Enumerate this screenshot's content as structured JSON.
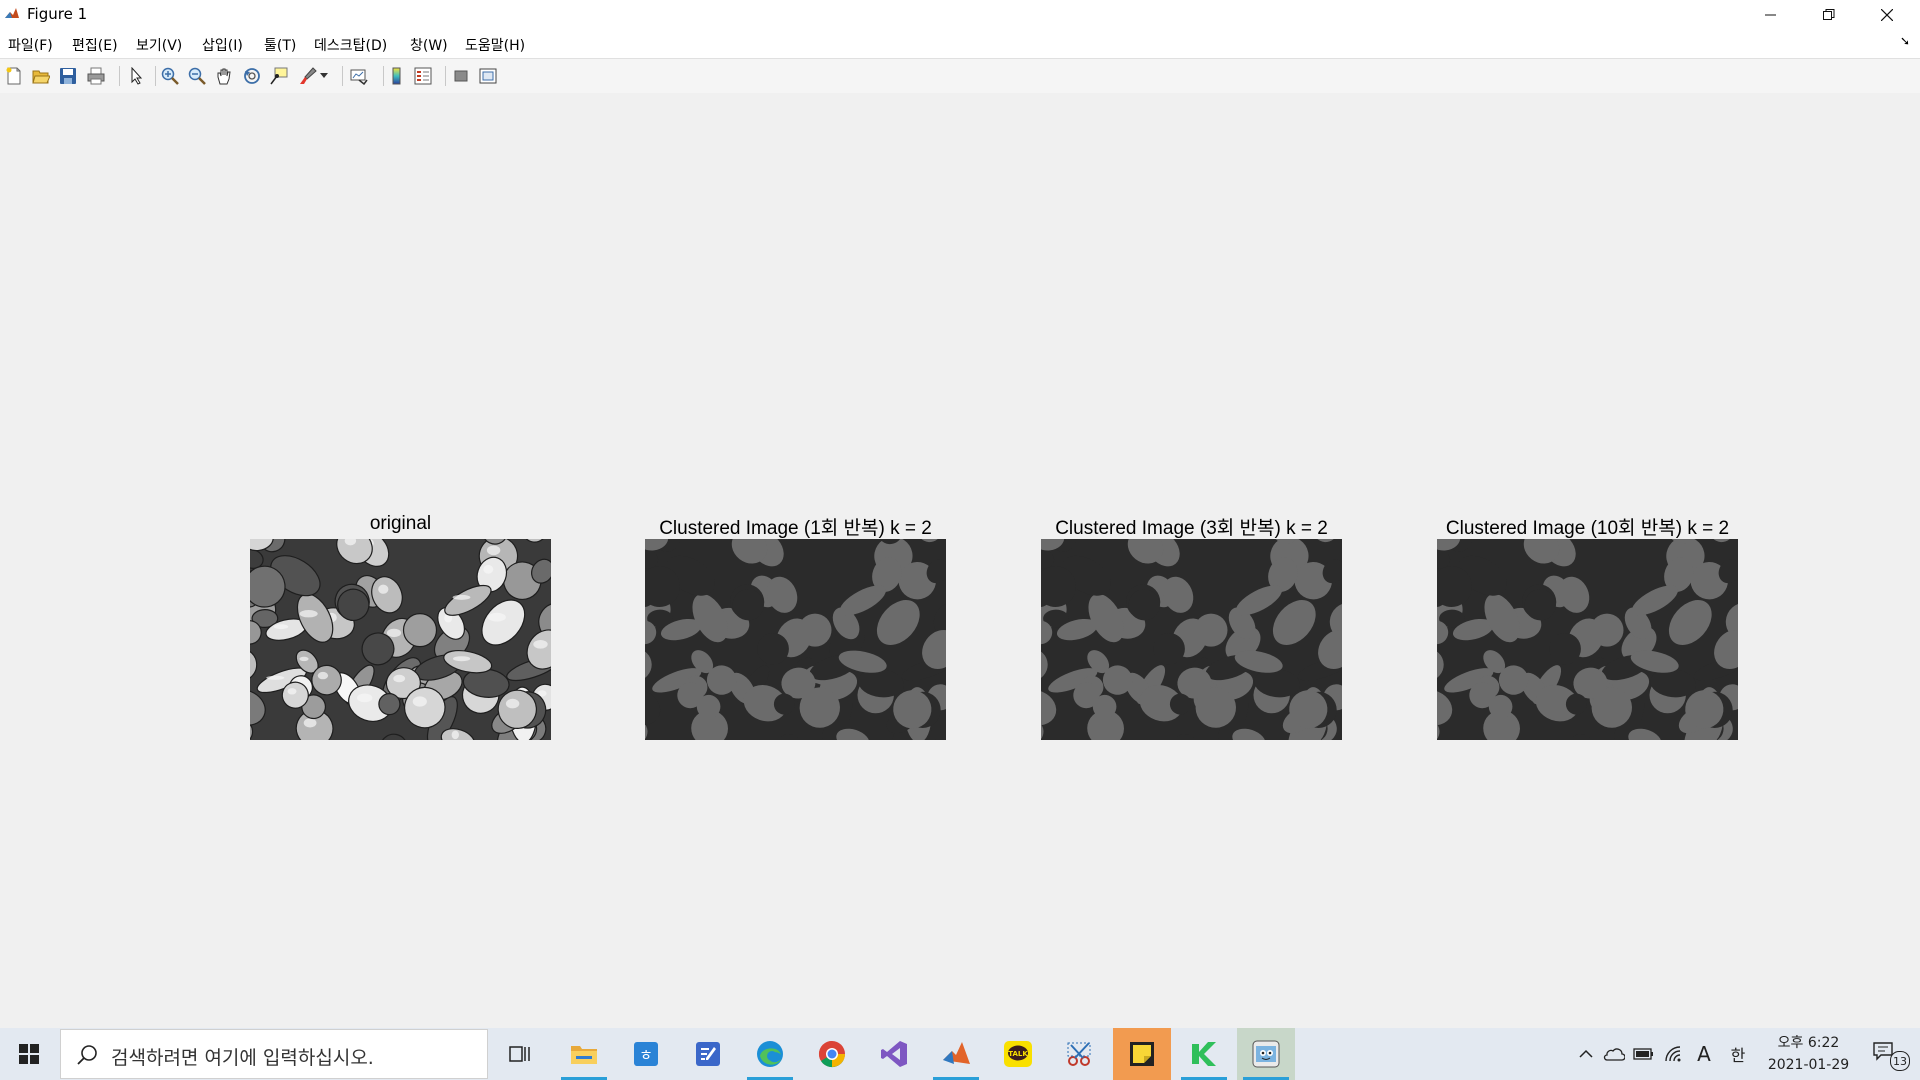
{
  "window": {
    "title": "Figure 1",
    "buttons": [
      "minimize",
      "restore",
      "close"
    ]
  },
  "menu": {
    "items": [
      "파일(F)",
      "편집(E)",
      "보기(V)",
      "삽입(I)",
      "툴(T)",
      "데스크탑(D)",
      "창(W)",
      "도움말(H)"
    ]
  },
  "toolbar": {
    "buttons": [
      "new-figure-icon",
      "open-file-icon",
      "save-icon",
      "print-icon",
      "edit-plot-icon",
      "zoom-in-icon",
      "zoom-out-icon",
      "pan-icon",
      "rotate-3d-icon",
      "data-cursor-icon",
      "brush-icon",
      "link-plot-icon",
      "colorbar-icon",
      "legend-icon",
      "hide-plot-tools-icon",
      "show-plot-tools-icon"
    ]
  },
  "figure": {
    "subplots": [
      {
        "title": "original",
        "kind": "grayscale-photo"
      },
      {
        "title": "Clustered Image (1회 반복) k = 2",
        "kind": "clustered"
      },
      {
        "title": "Clustered Image (3회 반복) k = 2",
        "kind": "clustered"
      },
      {
        "title": "Clustered Image (10회 반복) k = 2",
        "kind": "clustered"
      }
    ],
    "cluster_colors": {
      "dark": "#2b2b2b",
      "light": "#6b6b6b"
    }
  },
  "taskbar": {
    "search_placeholder": "검색하려면 여기에 입력하십시오.",
    "apps": [
      "task-view-icon",
      "file-explorer-icon",
      "hwp-icon",
      "notes-icon",
      "edge-icon",
      "chrome-icon",
      "visual-studio-icon",
      "matlab-icon",
      "kakaotalk-icon",
      "snipping-tool-icon",
      "sticky-notes-icon",
      "kite-icon",
      "photo-app-icon"
    ],
    "tray": {
      "ime": "A",
      "lang": "한",
      "notification_count": "13"
    },
    "time": "오후 6:22",
    "date": "2021-01-29"
  }
}
